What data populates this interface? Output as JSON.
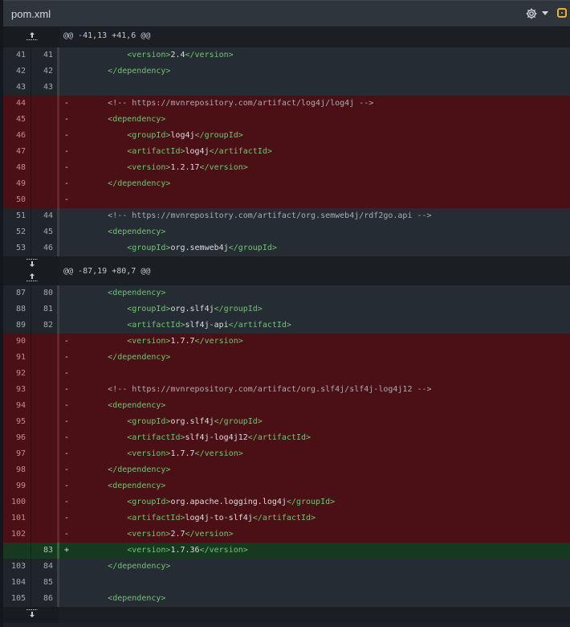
{
  "file": {
    "name": "pom.xml"
  },
  "toolbar": {
    "settings_icon": "gear-icon",
    "dropdown_icon": "caret-down-icon",
    "review_icon": "comment-review-icon",
    "accent": "#e8b033"
  },
  "colors": {
    "deleted_bg": "#4b1015",
    "added_bg": "#17391f",
    "context_bg": "#262c33",
    "tag": "#6cc86c"
  },
  "rows": [
    {
      "kind": "hunk",
      "header": "@@ -41,13 +41,6 @@",
      "expand": [
        "up"
      ]
    },
    {
      "kind": "ctx",
      "old": "41",
      "new": "41",
      "sign": "",
      "indent": "            ",
      "tokens": [
        [
          "tag",
          "<version>"
        ],
        [
          "txt",
          "2.4"
        ],
        [
          "tag",
          "</version>"
        ]
      ]
    },
    {
      "kind": "ctx",
      "old": "42",
      "new": "42",
      "sign": "",
      "indent": "        ",
      "tokens": [
        [
          "tag",
          "</dependency>"
        ]
      ]
    },
    {
      "kind": "ctx",
      "old": "43",
      "new": "43",
      "sign": "",
      "indent": "",
      "tokens": []
    },
    {
      "kind": "del",
      "old": "44",
      "new": "",
      "sign": "-",
      "indent": "        ",
      "tokens": [
        [
          "cmt",
          "<!-- https://mvnrepository.com/artifact/log4j/log4j -->"
        ]
      ]
    },
    {
      "kind": "del",
      "old": "45",
      "new": "",
      "sign": "-",
      "indent": "        ",
      "tokens": [
        [
          "tag",
          "<dependency>"
        ]
      ]
    },
    {
      "kind": "del",
      "old": "46",
      "new": "",
      "sign": "-",
      "indent": "            ",
      "tokens": [
        [
          "tag",
          "<groupId>"
        ],
        [
          "txt",
          "log4j"
        ],
        [
          "tag",
          "</groupId>"
        ]
      ]
    },
    {
      "kind": "del",
      "old": "47",
      "new": "",
      "sign": "-",
      "indent": "            ",
      "tokens": [
        [
          "tag",
          "<artifactId>"
        ],
        [
          "txt",
          "log4j"
        ],
        [
          "tag",
          "</artifactId>"
        ]
      ]
    },
    {
      "kind": "del",
      "old": "48",
      "new": "",
      "sign": "-",
      "indent": "            ",
      "tokens": [
        [
          "tag",
          "<version>"
        ],
        [
          "txt",
          "1.2.17"
        ],
        [
          "tag",
          "</version>"
        ]
      ]
    },
    {
      "kind": "del",
      "old": "49",
      "new": "",
      "sign": "-",
      "indent": "        ",
      "tokens": [
        [
          "tag",
          "</dependency>"
        ]
      ]
    },
    {
      "kind": "del",
      "old": "50",
      "new": "",
      "sign": "-",
      "indent": "",
      "tokens": []
    },
    {
      "kind": "ctx",
      "old": "51",
      "new": "44",
      "sign": "",
      "indent": "        ",
      "tokens": [
        [
          "cmt",
          "<!-- https://mvnrepository.com/artifact/org.semweb4j/rdf2go.api -->"
        ]
      ]
    },
    {
      "kind": "ctx",
      "old": "52",
      "new": "45",
      "sign": "",
      "indent": "        ",
      "tokens": [
        [
          "tag",
          "<dependency>"
        ]
      ]
    },
    {
      "kind": "ctx",
      "old": "53",
      "new": "46",
      "sign": "",
      "indent": "            ",
      "tokens": [
        [
          "tag",
          "<groupId>"
        ],
        [
          "txt",
          "org.semweb4j"
        ],
        [
          "tag",
          "</groupId>"
        ]
      ]
    },
    {
      "kind": "hunk",
      "header": "@@ -87,19 +80,7 @@",
      "expand": [
        "down",
        "up"
      ]
    },
    {
      "kind": "ctx",
      "old": "87",
      "new": "80",
      "sign": "",
      "indent": "        ",
      "tokens": [
        [
          "tag",
          "<dependency>"
        ]
      ]
    },
    {
      "kind": "ctx",
      "old": "88",
      "new": "81",
      "sign": "",
      "indent": "            ",
      "tokens": [
        [
          "tag",
          "<groupId>"
        ],
        [
          "txt",
          "org.slf4j"
        ],
        [
          "tag",
          "</groupId>"
        ]
      ]
    },
    {
      "kind": "ctx",
      "old": "89",
      "new": "82",
      "sign": "",
      "indent": "            ",
      "tokens": [
        [
          "tag",
          "<artifactId>"
        ],
        [
          "txt",
          "slf4j-api"
        ],
        [
          "tag",
          "</artifactId>"
        ]
      ]
    },
    {
      "kind": "del",
      "old": "90",
      "new": "",
      "sign": "-",
      "indent": "            ",
      "tokens": [
        [
          "tag",
          "<version>"
        ],
        [
          "txt",
          "1.7.7"
        ],
        [
          "tag",
          "</version>"
        ]
      ]
    },
    {
      "kind": "del",
      "old": "91",
      "new": "",
      "sign": "-",
      "indent": "        ",
      "tokens": [
        [
          "tag",
          "</dependency>"
        ]
      ]
    },
    {
      "kind": "del",
      "old": "92",
      "new": "",
      "sign": "-",
      "indent": "",
      "tokens": []
    },
    {
      "kind": "del",
      "old": "93",
      "new": "",
      "sign": "-",
      "indent": "        ",
      "tokens": [
        [
          "cmt",
          "<!-- https://mvnrepository.com/artifact/org.slf4j/slf4j-log4j12 -->"
        ]
      ]
    },
    {
      "kind": "del",
      "old": "94",
      "new": "",
      "sign": "-",
      "indent": "        ",
      "tokens": [
        [
          "tag",
          "<dependency>"
        ]
      ]
    },
    {
      "kind": "del",
      "old": "95",
      "new": "",
      "sign": "-",
      "indent": "            ",
      "tokens": [
        [
          "tag",
          "<groupId>"
        ],
        [
          "txt",
          "org.slf4j"
        ],
        [
          "tag",
          "</groupId>"
        ]
      ]
    },
    {
      "kind": "del",
      "old": "96",
      "new": "",
      "sign": "-",
      "indent": "            ",
      "tokens": [
        [
          "tag",
          "<artifactId>"
        ],
        [
          "txt",
          "slf4j-log4j12"
        ],
        [
          "tag",
          "</artifactId>"
        ]
      ]
    },
    {
      "kind": "del",
      "old": "97",
      "new": "",
      "sign": "-",
      "indent": "            ",
      "tokens": [
        [
          "tag",
          "<version>"
        ],
        [
          "txt",
          "1.7.7"
        ],
        [
          "tag",
          "</version>"
        ]
      ]
    },
    {
      "kind": "del",
      "old": "98",
      "new": "",
      "sign": "-",
      "indent": "        ",
      "tokens": [
        [
          "tag",
          "</dependency>"
        ]
      ]
    },
    {
      "kind": "del",
      "old": "99",
      "new": "",
      "sign": "-",
      "indent": "        ",
      "tokens": [
        [
          "tag",
          "<dependency>"
        ]
      ]
    },
    {
      "kind": "del",
      "old": "100",
      "new": "",
      "sign": "-",
      "indent": "            ",
      "tokens": [
        [
          "tag",
          "<groupId>"
        ],
        [
          "txt",
          "org.apache.logging.log4j"
        ],
        [
          "tag",
          "</groupId>"
        ]
      ]
    },
    {
      "kind": "del",
      "old": "101",
      "new": "",
      "sign": "-",
      "indent": "            ",
      "tokens": [
        [
          "tag",
          "<artifactId>"
        ],
        [
          "txt",
          "log4j-to-slf4j"
        ],
        [
          "tag",
          "</artifactId>"
        ]
      ]
    },
    {
      "kind": "del",
      "old": "102",
      "new": "",
      "sign": "-",
      "indent": "            ",
      "tokens": [
        [
          "tag",
          "<version>"
        ],
        [
          "txt",
          "2.7"
        ],
        [
          "tag",
          "</version>"
        ]
      ]
    },
    {
      "kind": "add",
      "old": "",
      "new": "83",
      "sign": "+",
      "indent": "            ",
      "tokens": [
        [
          "tag",
          "<version>"
        ],
        [
          "txt",
          "1.7.36"
        ],
        [
          "tag",
          "</version>"
        ]
      ]
    },
    {
      "kind": "ctx",
      "old": "103",
      "new": "84",
      "sign": "",
      "indent": "        ",
      "tokens": [
        [
          "tag",
          "</dependency>"
        ]
      ]
    },
    {
      "kind": "ctx",
      "old": "104",
      "new": "85",
      "sign": "",
      "indent": "",
      "tokens": []
    },
    {
      "kind": "ctx",
      "old": "105",
      "new": "86",
      "sign": "",
      "indent": "        ",
      "tokens": [
        [
          "tag",
          "<dependency>"
        ]
      ]
    },
    {
      "kind": "hunk",
      "header": "",
      "expand": [
        "down"
      ]
    }
  ]
}
